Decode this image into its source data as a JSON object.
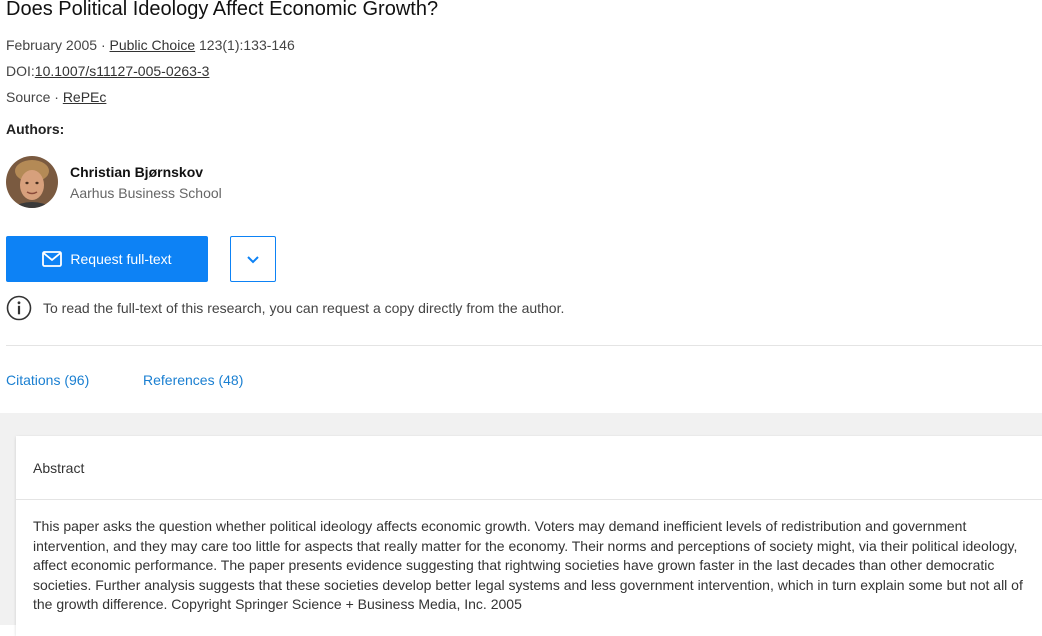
{
  "article": {
    "title": "Does Political Ideology Affect Economic Growth?",
    "date": "February 2005",
    "sep": " · ",
    "journal": "Public Choice",
    "issue": " 123(1):133-146",
    "doi_label": "DOI:",
    "doi": "10.1007/s11127-005-0263-3",
    "source_label": "Source",
    "source": "RePEc"
  },
  "authors": {
    "label": "Authors:",
    "items": [
      {
        "name": "Christian Bjørnskov",
        "affiliation": "Aarhus Business School"
      }
    ]
  },
  "actions": {
    "request_label": "Request full-text",
    "info_text": "To read the full-text of this research, you can request a copy directly from the author."
  },
  "tabs": [
    {
      "label": "Citations (96)"
    },
    {
      "label": "References (48)"
    }
  ],
  "abstract": {
    "heading": "Abstract",
    "text": "This paper asks the question whether political ideology affects economic growth. Voters may demand inefficient levels of redistribution and government intervention, and they may care too little for aspects that really matter for the economy. Their norms and perceptions of society might, via their political ideology, affect economic performance. The paper presents evidence suggesting that rightwing societies have grown faster in the last decades than other democratic societies. Further analysis suggests that these societies develop better legal systems and less government intervention, which in turn explain some but not all of the growth difference. Copyright Springer Science + Business Media, Inc. 2005"
  },
  "icons": {
    "mail": "mail-icon",
    "chevron": "chevron-down-icon",
    "info": "info-icon"
  },
  "colors": {
    "accent": "#0d82f5",
    "link": "#1a7fd1",
    "band": "#f1f1f1"
  }
}
